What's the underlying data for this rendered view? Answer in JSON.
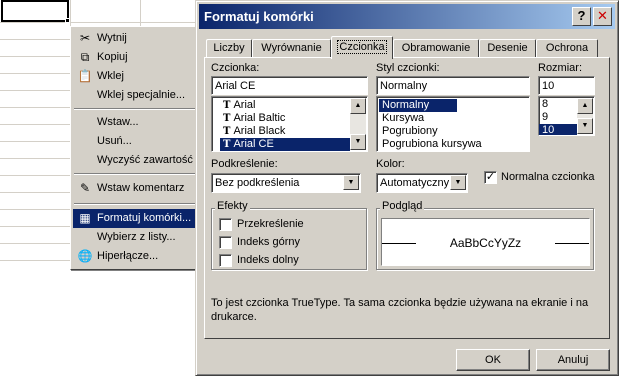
{
  "context_menu": {
    "items": [
      {
        "label": "Wytnij",
        "icon": "scissors-icon"
      },
      {
        "label": "Kopiuj",
        "icon": "copy-icon"
      },
      {
        "label": "Wklej",
        "icon": "paste-icon"
      },
      {
        "label": "Wklej specjalnie...",
        "icon": ""
      },
      {
        "label": "Wstaw...",
        "icon": ""
      },
      {
        "label": "Usuń...",
        "icon": ""
      },
      {
        "label": "Wyczyść zawartość",
        "icon": ""
      },
      {
        "label": "Wstaw komentarz",
        "icon": "comment-icon"
      },
      {
        "label": "Formatuj komórki...",
        "icon": "format-cells-icon",
        "selected": true
      },
      {
        "label": "Wybierz z listy...",
        "icon": ""
      },
      {
        "label": "Hiperłącze...",
        "icon": "hyperlink-icon"
      }
    ]
  },
  "dialog": {
    "title": "Formatuj komórki",
    "help_glyph": "?",
    "close_glyph": "✕",
    "tabs": [
      "Liczby",
      "Wyrównanie",
      "Czcionka",
      "Obramowanie",
      "Desenie",
      "Ochrona"
    ],
    "active_tab": "Czcionka",
    "font": {
      "label": "Czcionka:",
      "value": "Arial CE",
      "options": [
        "Arial",
        "Arial Baltic",
        "Arial Black",
        "Arial CE"
      ],
      "selected": "Arial CE",
      "truetype_glyph": "T"
    },
    "style": {
      "label": "Styl czcionki:",
      "value": "Normalny",
      "options": [
        "Normalny",
        "Kursywa",
        "Pogrubiony",
        "Pogrubiona kursywa"
      ],
      "selected": "Normalny"
    },
    "size": {
      "label": "Rozmiar:",
      "value": "10",
      "options": [
        "8",
        "9",
        "10"
      ],
      "selected": "10"
    },
    "underline": {
      "label": "Podkreślenie:",
      "value": "Bez podkreślenia"
    },
    "color": {
      "label": "Kolor:",
      "value": "Automatyczny"
    },
    "normal_font": {
      "label": "Normalna czcionka",
      "checked": true
    },
    "effects": {
      "title": "Efekty",
      "strikethrough": "Przekreślenie",
      "superscript": "Indeks górny",
      "subscript": "Indeks dolny"
    },
    "preview": {
      "title": "Podgląd",
      "sample": "AaBbCcYyZz"
    },
    "info": "To jest czcionka TrueType. Ta sama czcionka będzie używana na ekranie i na drukarce.",
    "ok_label": "OK",
    "cancel_label": "Anuluj"
  },
  "colors": {
    "selection": "#0a246a",
    "face": "#d4d0c8",
    "title_gradient_start": "#0a246a",
    "title_gradient_end": "#a6caf0"
  }
}
